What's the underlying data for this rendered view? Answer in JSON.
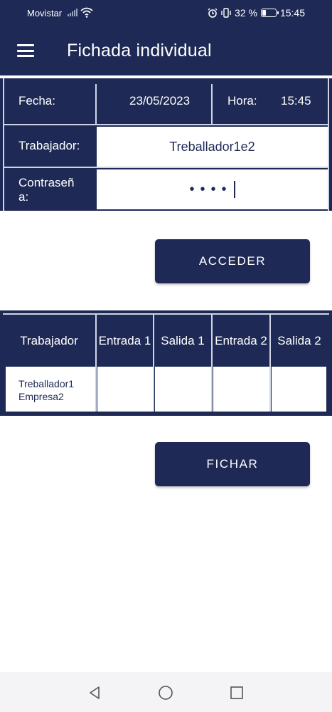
{
  "status_bar": {
    "carrier": "Movistar",
    "battery_text": "32 %",
    "battery_level": 0.32,
    "time": "15:45"
  },
  "app_bar": {
    "title": "Fichada individual",
    "menu_icon": "hamburger-menu-icon"
  },
  "form": {
    "fecha_label": "Fecha:",
    "fecha_value": "23/05/2023",
    "hora_label": "Hora:",
    "hora_value": "15:45",
    "trabajador_label": "Trabajador:",
    "trabajador_value": "Treballador1e2",
    "password_label_line1": "Contraseñ",
    "password_label_line2": "a:",
    "password_value": "••••"
  },
  "buttons": {
    "acceder": "ACCEDER",
    "fichar": "FICHAR"
  },
  "table": {
    "headers": [
      "Trabajador",
      "Entrada 1",
      "Salida 1",
      "Entrada 2",
      "Salida 2"
    ],
    "rows": [
      {
        "trabajador_line1": "Treballador1",
        "trabajador_line2": "Empresa2",
        "entrada1": "",
        "salida1": "",
        "entrada2": "",
        "salida2": ""
      }
    ]
  },
  "colors": {
    "primary": "#1e2a55",
    "background": "#ffffff"
  }
}
